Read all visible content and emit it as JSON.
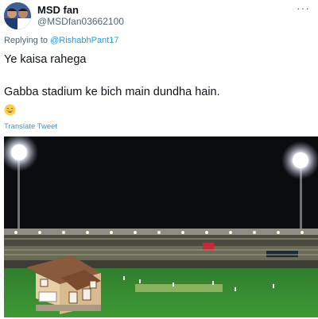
{
  "tweet": {
    "display_name": "MSD fan",
    "handle": "@MSDfan03662100",
    "more_icon": "more-dots-icon",
    "replying_prefix": "Replying to",
    "replying_to": "@RishabhPant17",
    "line1": "Ye kaisa rahega",
    "line2": "Gabba stadium ke bich main dundha hain.",
    "emoji": "grinning-face-emoji",
    "translate_label": "Translate Tweet"
  },
  "colors": {
    "link": "#1d9bf0",
    "secondary_text": "#536471",
    "primary_text": "#0f1419"
  }
}
